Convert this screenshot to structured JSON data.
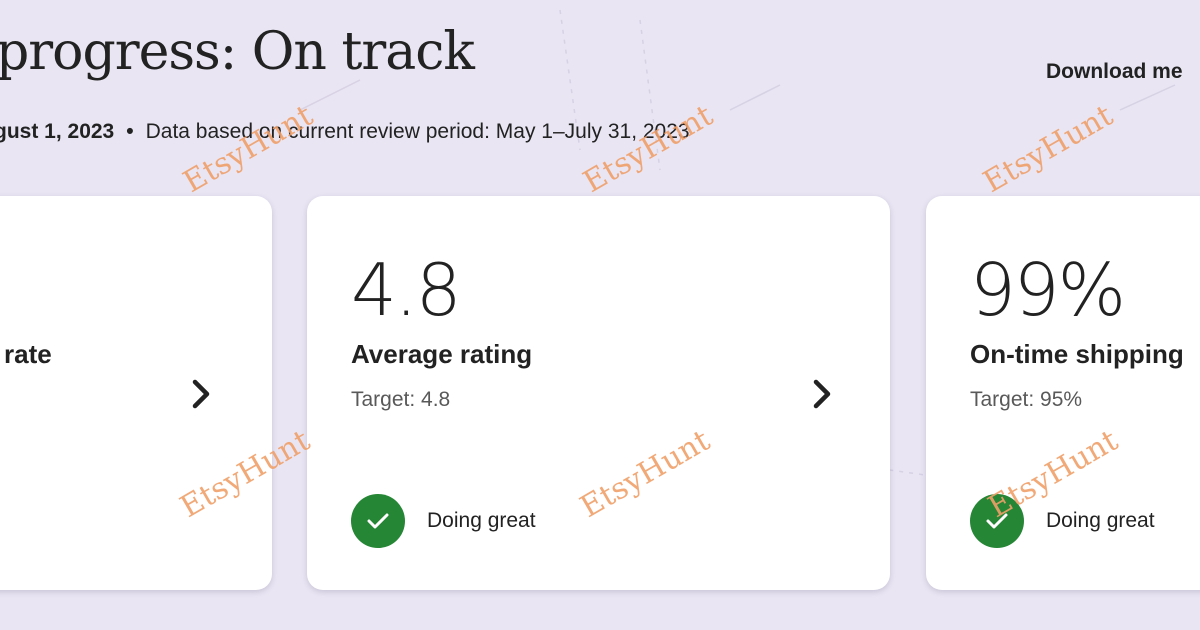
{
  "header": {
    "title": "progress: On track",
    "download_label": "Download me",
    "updated_text": "gust 1, 2023",
    "separator": "•",
    "period_text": "Data based on current review period: May 1–July 31, 2023"
  },
  "cards": [
    {
      "value": "",
      "label": "rate",
      "target": "",
      "status": ""
    },
    {
      "value": "4.8",
      "label": "Average rating",
      "target": "Target: 4.8",
      "status": "Doing great"
    },
    {
      "value": "99%",
      "label": "On-time shipping",
      "target": "Target: 95%",
      "status": "Doing great"
    }
  ],
  "watermark": "EtsyHunt",
  "colors": {
    "background": "#e9e5f3",
    "status_green": "#258635",
    "watermark": "#f0a06a"
  },
  "icons": {
    "chevron": "chevron-right-icon",
    "check": "check-circle-icon"
  }
}
